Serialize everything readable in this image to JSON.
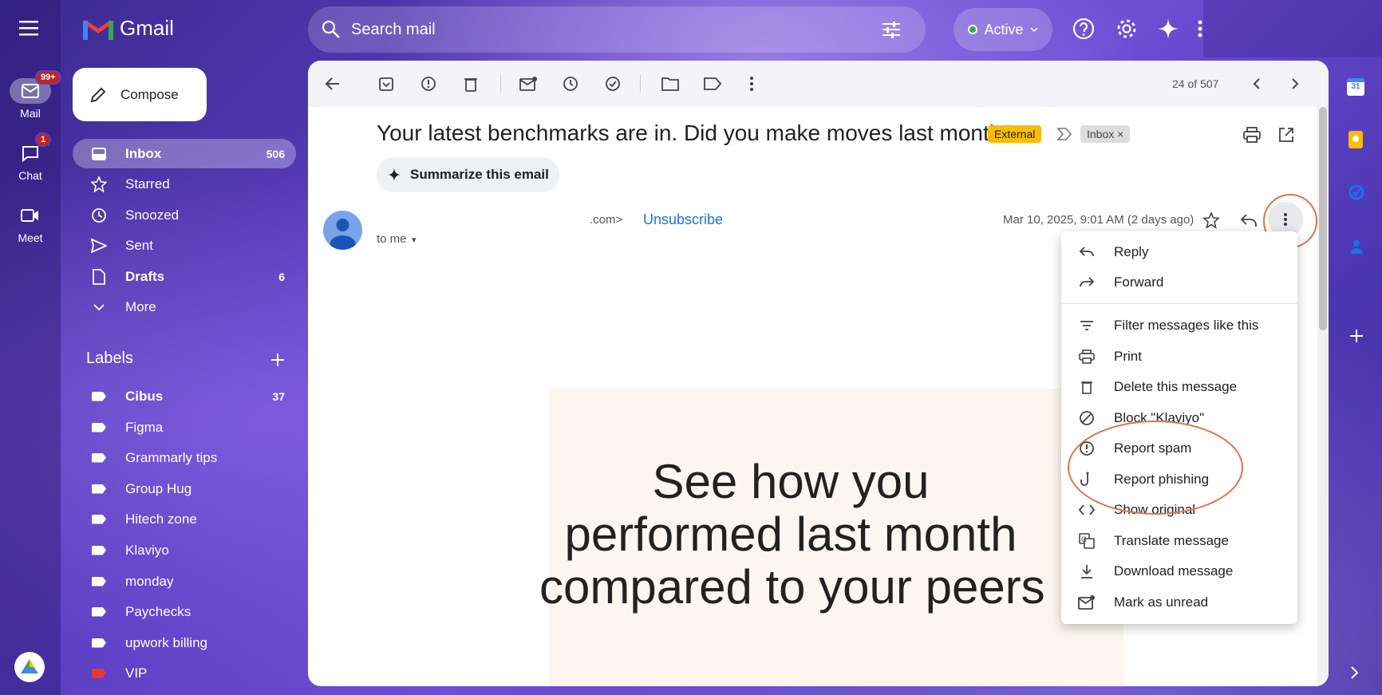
{
  "app": {
    "brand": "Gmail"
  },
  "rail": {
    "items": [
      {
        "label": "Mail",
        "badge": "99+"
      },
      {
        "label": "Chat",
        "badge": "1"
      },
      {
        "label": "Meet"
      }
    ]
  },
  "compose": {
    "label": "Compose"
  },
  "nav": [
    {
      "label": "Inbox",
      "count": "506",
      "icon": "inbox-icon"
    },
    {
      "label": "Starred",
      "count": "",
      "icon": "star-icon"
    },
    {
      "label": "Snoozed",
      "count": "",
      "icon": "clock-icon"
    },
    {
      "label": "Sent",
      "count": "",
      "icon": "send-icon"
    },
    {
      "label": "Drafts",
      "count": "6",
      "icon": "draft-icon"
    },
    {
      "label": "More",
      "count": "",
      "icon": "chevron-down-icon"
    }
  ],
  "labels": {
    "title": "Labels",
    "items": [
      {
        "name": "Cibus",
        "count": "37",
        "color": "#ffffff"
      },
      {
        "name": "Figma",
        "count": "",
        "color": "#ffffff"
      },
      {
        "name": "Grammarly tips",
        "count": "",
        "color": "#ffffff"
      },
      {
        "name": "Group Hug",
        "count": "",
        "color": "#ffffff"
      },
      {
        "name": "Hitech zone",
        "count": "",
        "color": "#ffffff"
      },
      {
        "name": "Klaviyo",
        "count": "",
        "color": "#ffffff"
      },
      {
        "name": "monday",
        "count": "",
        "color": "#ffffff"
      },
      {
        "name": "Paychecks",
        "count": "",
        "color": "#ffffff"
      },
      {
        "name": "upwork billing",
        "count": "",
        "color": "#ffffff"
      },
      {
        "name": "VIP",
        "count": "",
        "color": "#e53935"
      }
    ]
  },
  "search": {
    "placeholder": "Search mail"
  },
  "status": {
    "label": "Active",
    "color": "#34a853"
  },
  "toolbar": {
    "pagination": "24 of 507"
  },
  "email": {
    "subject": "Your latest benchmarks are in. Did you make moves last month?",
    "external_chip": "External",
    "inbox_chip": "Inbox",
    "summarize": "Summarize this email",
    "sender_suffix": ".com>",
    "unsubscribe": "Unsubscribe",
    "to": "to me",
    "date": "Mar 10, 2025, 9:01 AM (2 days ago)",
    "hero_line1": "See how you",
    "hero_line2": "performed last month",
    "hero_line3": "compared to your peers"
  },
  "menu": {
    "items": [
      {
        "label": "Reply",
        "icon": "reply-icon"
      },
      {
        "label": "Forward",
        "icon": "forward-icon"
      },
      {
        "label": "Filter messages like this",
        "icon": "filter-icon"
      },
      {
        "label": "Print",
        "icon": "print-icon"
      },
      {
        "label": "Delete this message",
        "icon": "trash-icon"
      },
      {
        "label": "Block \"Klaviyo\"",
        "icon": "block-icon"
      },
      {
        "label": "Report spam",
        "icon": "report-spam-icon"
      },
      {
        "label": "Report phishing",
        "icon": "phishing-hook-icon"
      },
      {
        "label": "Show original",
        "icon": "code-icon"
      },
      {
        "label": "Translate message",
        "icon": "translate-icon"
      },
      {
        "label": "Download message",
        "icon": "download-icon"
      },
      {
        "label": "Mark as unread",
        "icon": "mark-unread-icon"
      }
    ]
  },
  "colors": {
    "accent_circle": "#e0734d",
    "external_chip": "#fbbc04"
  }
}
